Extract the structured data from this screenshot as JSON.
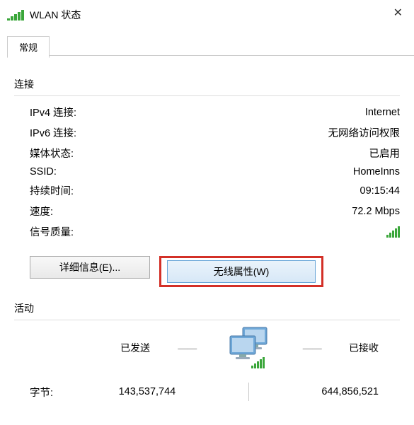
{
  "titlebar": {
    "title": "WLAN 状态",
    "close": "✕"
  },
  "tabs": {
    "general": "常规"
  },
  "sections": {
    "connection": "连接",
    "activity": "活动"
  },
  "conn": {
    "ipv4_label": "IPv4 连接:",
    "ipv4_value": "Internet",
    "ipv6_label": "IPv6 连接:",
    "ipv6_value": "无网络访问权限",
    "media_label": "媒体状态:",
    "media_value": "已启用",
    "ssid_label": "SSID:",
    "ssid_value": "HomeInns",
    "duration_label": "持续时间:",
    "duration_value": "09:15:44",
    "speed_label": "速度:",
    "speed_value": "72.2 Mbps",
    "signal_label": "信号质量:"
  },
  "buttons": {
    "details": "详细信息(E)...",
    "wireless_props": "无线属性(W)"
  },
  "activity": {
    "sent_label": "已发送",
    "recv_label": "已接收",
    "bytes_label": "字节:",
    "sent_bytes": "143,537,744",
    "recv_bytes": "644,856,521"
  }
}
